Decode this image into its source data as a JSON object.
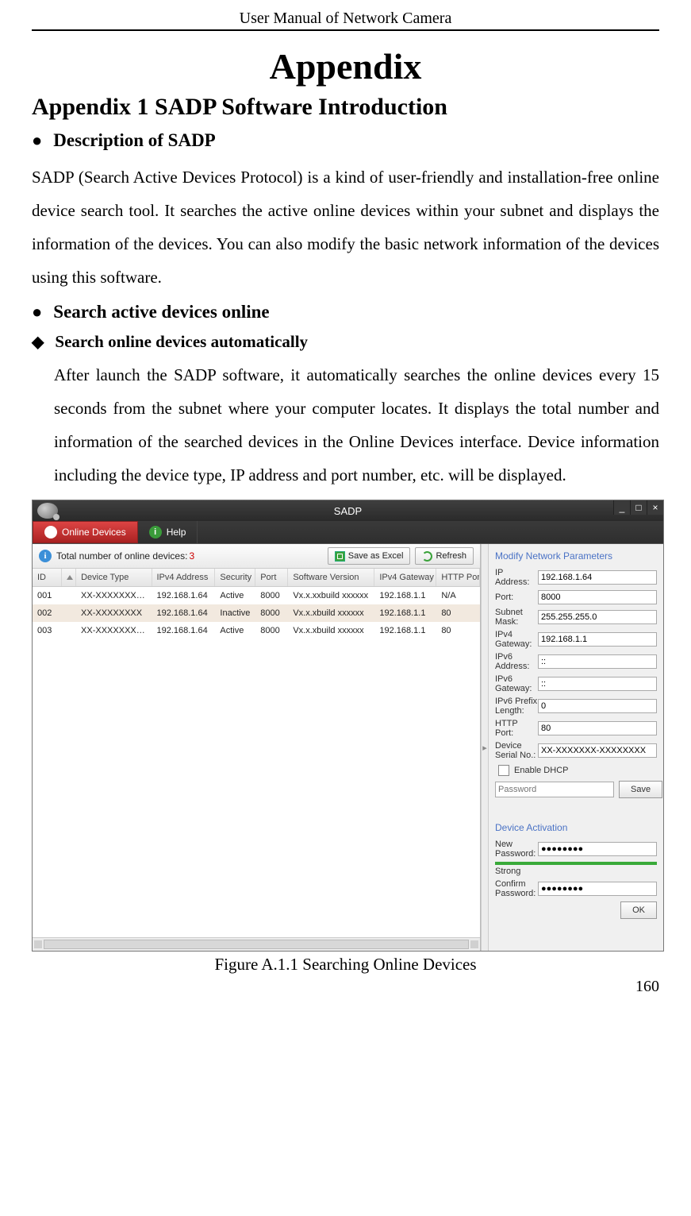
{
  "doc": {
    "header": "User Manual of Network Camera",
    "appendix_title": "Appendix",
    "h1": "Appendix 1 SADP Software Introduction",
    "bullet1": "Description of SADP",
    "para1": "SADP (Search Active Devices Protocol) is a kind of user-friendly and installation-free online device search tool. It searches the active online devices within your subnet and displays the information of the devices. You can also modify the basic network information of the devices using this software.",
    "bullet2": "Search active devices online",
    "diamond1": "Search online devices automatically",
    "para2": "After launch the SADP software, it automatically searches the online devices every 15 seconds from the subnet where your computer locates. It displays the total number and information of the searched devices in the Online Devices interface. Device information including the device type, IP address and port number, etc. will be displayed.",
    "figure_caption": "Figure A.1.1 Searching Online Devices",
    "page_no": "160"
  },
  "app": {
    "title": "SADP",
    "tabs": {
      "online": "Online Devices",
      "help": "Help",
      "help_icon": "i"
    },
    "totalbar": {
      "info_icon": "i",
      "label": "Total number of online devices:",
      "count": "3",
      "save_excel": "Save as Excel",
      "refresh": "Refresh"
    },
    "cols": {
      "id": "ID",
      "type": "Device Type",
      "ip": "IPv4 Address",
      "sec": "Security",
      "port": "Port",
      "ver": "Software Version",
      "gw": "IPv4 Gateway",
      "http": "HTTP Port"
    },
    "rows": [
      {
        "id": "001",
        "type": "XX-XXXXXXXX-X",
        "ip": "192.168.1.64",
        "sec": "Active",
        "port": "8000",
        "ver": "Vx.x.xxbuild xxxxxx",
        "gw": "192.168.1.1",
        "http": "N/A"
      },
      {
        "id": "002",
        "type": "XX-XXXXXXXX",
        "ip": "192.168.1.64",
        "sec": "Inactive",
        "port": "8000",
        "ver": "Vx.x.xbuild xxxxxx",
        "gw": "192.168.1.1",
        "http": "80"
      },
      {
        "id": "003",
        "type": "XX-XXXXXXXXXX",
        "ip": "192.168.1.64",
        "sec": "Active",
        "port": "8000",
        "ver": "Vx.x.xbuild xxxxxx",
        "gw": "192.168.1.1",
        "http": "80"
      }
    ],
    "right": {
      "title": "Modify Network Parameters",
      "fields": {
        "ip": {
          "label": "IP Address:",
          "value": "192.168.1.64"
        },
        "port": {
          "label": "Port:",
          "value": "8000"
        },
        "mask": {
          "label": "Subnet Mask:",
          "value": "255.255.255.0"
        },
        "gw": {
          "label": "IPv4 Gateway:",
          "value": "192.168.1.1"
        },
        "ip6": {
          "label": "IPv6 Address:",
          "value": "::"
        },
        "gw6": {
          "label": "IPv6 Gateway:",
          "value": "::"
        },
        "pre": {
          "label": "IPv6 Prefix Length:",
          "value": "0"
        },
        "http": {
          "label": "HTTP Port:",
          "value": "80"
        },
        "sn": {
          "label": "Device Serial No.:",
          "value": "XX-XXXXXXX-XXXXXXXX"
        }
      },
      "dhcp": "Enable DHCP",
      "password_placeholder": "Password",
      "save": "Save",
      "activation_title": "Device Activation",
      "newpw_label": "New Password:",
      "newpw_value": "●●●●●●●●",
      "strength": "Strong",
      "confirm_label": "Confirm Password:",
      "confirm_value": "●●●●●●●●",
      "ok": "OK"
    },
    "win": {
      "min": "_",
      "max": "□",
      "close": "×"
    }
  }
}
